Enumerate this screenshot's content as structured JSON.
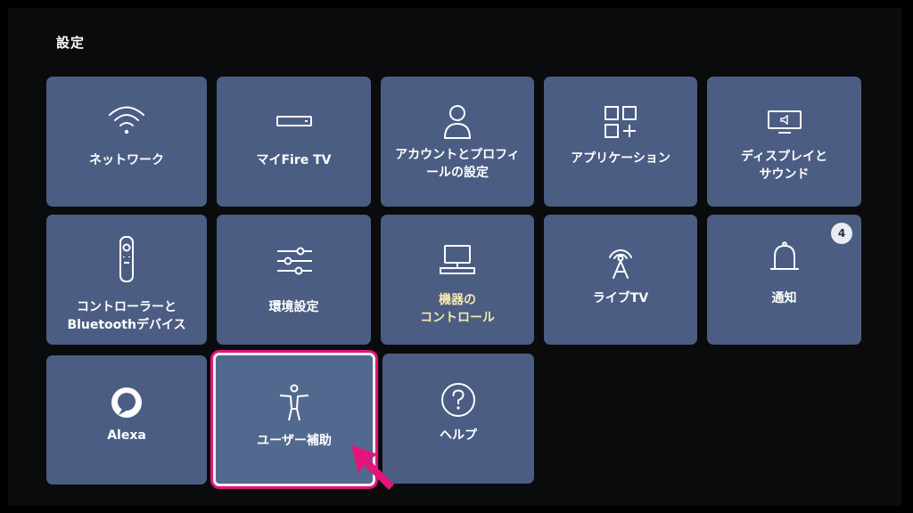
{
  "header": {
    "title": "設定"
  },
  "tiles": [
    {
      "id": "network",
      "label": "ネットワーク",
      "icon": "wifi-icon"
    },
    {
      "id": "my-fire-tv",
      "label": "マイFire TV",
      "icon": "fire-tv-stick-icon"
    },
    {
      "id": "account",
      "label": "アカウントとプロフィ\nールの設定",
      "icon": "person-icon"
    },
    {
      "id": "applications",
      "label": "アプリケーション",
      "icon": "apps-grid-icon"
    },
    {
      "id": "display-sound",
      "label": "ディスプレイと\nサウンド",
      "icon": "display-icon"
    },
    {
      "id": "controllers",
      "label": "コントローラーと\nBluetoothデバイス",
      "icon": "remote-icon"
    },
    {
      "id": "preferences",
      "label": "環境設定",
      "icon": "sliders-icon"
    },
    {
      "id": "equipment-control",
      "label": "機器の\nコントロール",
      "icon": "computer-icon"
    },
    {
      "id": "live-tv",
      "label": "ライブTV",
      "icon": "broadcast-icon"
    },
    {
      "id": "notifications",
      "label": "通知",
      "icon": "bell-icon",
      "badge": "4"
    },
    {
      "id": "alexa",
      "label": "Alexa",
      "icon": "alexa-icon"
    },
    {
      "id": "accessibility",
      "label": "ユーザー補助",
      "icon": "accessibility-icon",
      "focused": true
    },
    {
      "id": "help",
      "label": "ヘルプ",
      "icon": "help-icon"
    }
  ],
  "colors": {
    "tile": "#4b5d83",
    "focus_ring": "#e3157a",
    "highlight_label": "#f5e9a8",
    "arrow": "#e3157a"
  }
}
